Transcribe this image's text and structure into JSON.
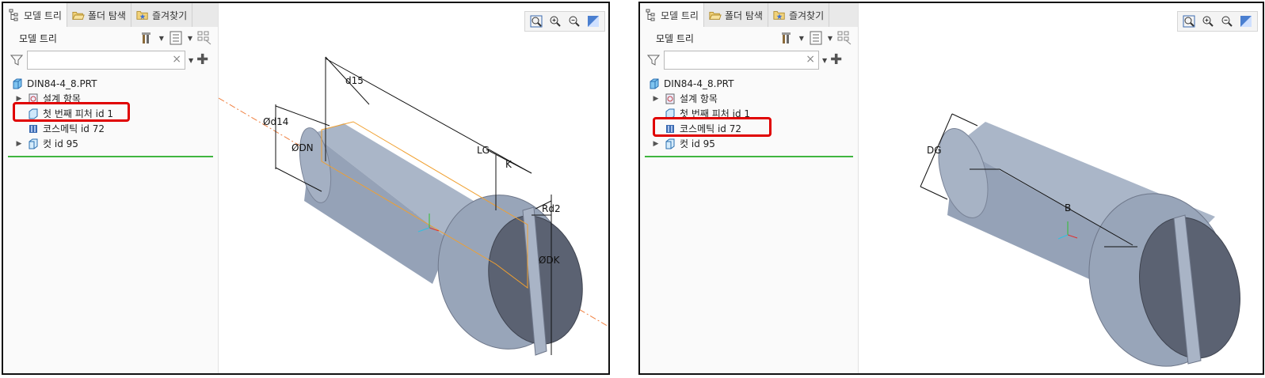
{
  "left": {
    "tabs": [
      {
        "label": "모델 트리",
        "icon": "model-tree-icon"
      },
      {
        "label": "폴더 탐색",
        "icon": "folder-browser-icon"
      },
      {
        "label": "즐겨찾기",
        "icon": "favorites-icon"
      }
    ],
    "tree_title": "모델 트리",
    "search": {
      "value": "",
      "placeholder": ""
    },
    "tree_items": [
      {
        "label": "DIN84-4_8.PRT",
        "icon": "part-icon"
      },
      {
        "label": "설계 항목",
        "icon": "design-items-icon"
      },
      {
        "label": "첫 번째 피처 id 1",
        "icon": "feature-icon"
      },
      {
        "label": "코스메틱 id 72",
        "icon": "cosmetic-icon"
      },
      {
        "label": "컷 id 95",
        "icon": "cut-icon"
      }
    ],
    "dimensions": [
      "d15",
      "Ød14",
      "ØDN",
      "LG",
      "K",
      "Rd2",
      "ØDK"
    ]
  },
  "right": {
    "tabs": [
      {
        "label": "모델 트리",
        "icon": "model-tree-icon"
      },
      {
        "label": "폴더 탐색",
        "icon": "folder-browser-icon"
      },
      {
        "label": "즐겨찾기",
        "icon": "favorites-icon"
      }
    ],
    "tree_title": "모델 트리",
    "search": {
      "value": "",
      "placeholder": ""
    },
    "tree_items": [
      {
        "label": "DIN84-4_8.PRT",
        "icon": "part-icon"
      },
      {
        "label": "설계 항목",
        "icon": "design-items-icon"
      },
      {
        "label": "첫 번째 피처 id 1",
        "icon": "feature-icon"
      },
      {
        "label": "코스메틱 id 72",
        "icon": "cosmetic-icon"
      },
      {
        "label": "컷 id 95",
        "icon": "cut-icon"
      }
    ],
    "dimensions": [
      "DG",
      "B"
    ]
  },
  "colors": {
    "highlight": "#e00000",
    "separator": "#3fb53f",
    "model_body": "#a9b4c6",
    "model_dark": "#555c6b",
    "sketch": "#f0a030",
    "axis_line": "#f08040"
  }
}
